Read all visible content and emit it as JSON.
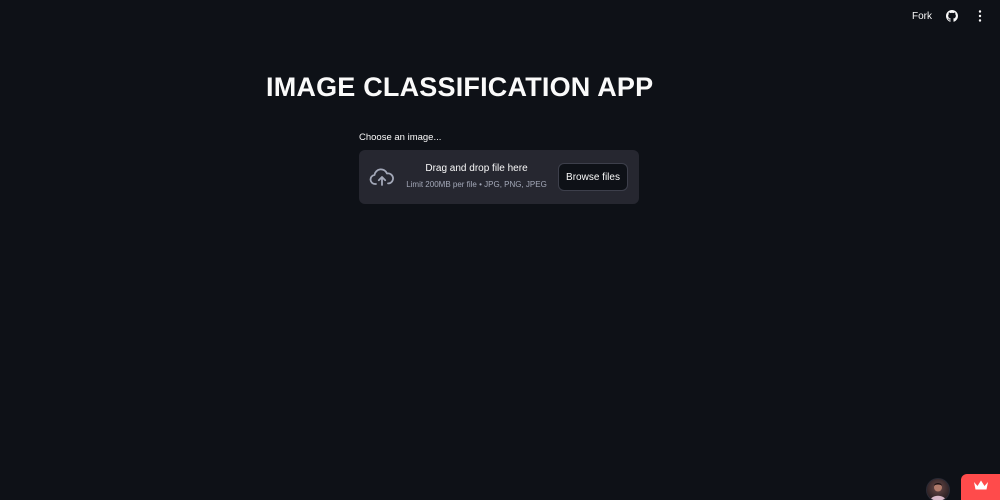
{
  "header": {
    "fork_label": "Fork",
    "github_icon": "github-icon",
    "menu_icon": "kebab-menu-icon"
  },
  "main": {
    "title": "IMAGE CLASSIFICATION APP",
    "uploader": {
      "label": "Choose an image...",
      "drop_text": "Drag and drop file here",
      "limit_text": "Limit 200MB per file • JPG, PNG, JPEG",
      "browse_label": "Browse files",
      "icon": "cloud-upload-icon"
    }
  },
  "footer": {
    "avatar_icon": "user-avatar",
    "badge_icon": "crown-icon"
  },
  "colors": {
    "background": "#0e1117",
    "panel": "#262730",
    "accent": "#ff4b4b",
    "text": "#fafafa",
    "muted_text": "#a3a8b8"
  }
}
